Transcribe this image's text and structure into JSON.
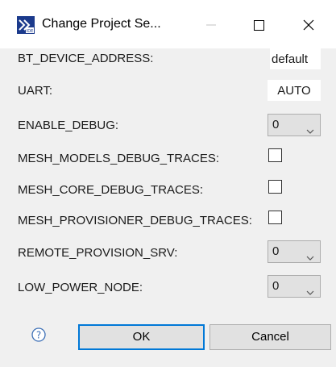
{
  "window": {
    "title": "Change Project Se...",
    "icon": "ide-icon",
    "controls": [
      "minimize-icon",
      "maximize-icon",
      "close-icon"
    ]
  },
  "form": {
    "bt_device_address": {
      "label": "BT_DEVICE_ADDRESS:",
      "value": "default"
    },
    "uart": {
      "label": "UART:",
      "value": "AUTO"
    },
    "enable_debug": {
      "label": "ENABLE_DEBUG:",
      "value": "0"
    },
    "mesh_models_debug_traces": {
      "label": "MESH_MODELS_DEBUG_TRACES:",
      "checked": false
    },
    "mesh_core_debug_traces": {
      "label": "MESH_CORE_DEBUG_TRACES:",
      "checked": false
    },
    "mesh_provisioner_debug_traces": {
      "label": "MESH_PROVISIONER_DEBUG_TRACES:",
      "checked": false
    },
    "remote_provision_srv": {
      "label": "REMOTE_PROVISION_SRV:",
      "value": "0"
    },
    "low_power_node": {
      "label": "LOW_POWER_NODE:",
      "value": "0"
    }
  },
  "buttons": {
    "help_icon": "question-circle-icon",
    "ok": "OK",
    "cancel": "Cancel"
  },
  "colors": {
    "dialog_bg": "#f0f0f0",
    "title_bg": "#ffffff",
    "default_button_border": "#0078d7"
  }
}
